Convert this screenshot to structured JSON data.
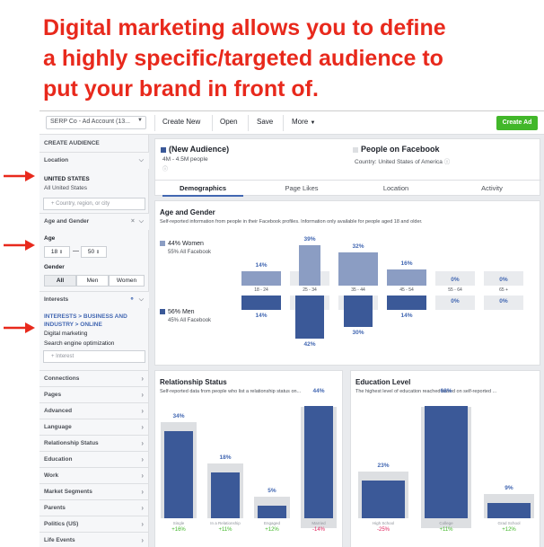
{
  "headline": {
    "line1": "Digital marketing allows you to define",
    "line2": "a highly specific/targeted audience to",
    "line3": "put your brand in front of."
  },
  "colors": {
    "headline": "#e8291c",
    "arrow": "#e8291c",
    "accent": "#4267b2",
    "women": "#8b9dc3",
    "men": "#3b5998",
    "green": "#42b72a",
    "negative": "#e0245e"
  },
  "topbar": {
    "account": "SERP Co - Ad Account (13...",
    "create_new": "Create New",
    "open": "Open",
    "save": "Save",
    "more": "More",
    "create_ad": "Create Ad"
  },
  "sidebar": {
    "title": "CREATE AUDIENCE",
    "location": {
      "header": "Location",
      "country": "UNITED STATES",
      "sub": "All United States",
      "placeholder": "Country, region, or city"
    },
    "age_gender": {
      "header": "Age and Gender",
      "age_label": "Age",
      "age_from": "18",
      "age_to": "50",
      "gender_label": "Gender",
      "options": [
        "All",
        "Men",
        "Women"
      ]
    },
    "interests": {
      "header": "Interests",
      "path": "INTERESTS > BUSINESS AND INDUSTRY > ONLINE",
      "items": [
        "Digital marketing",
        "Search engine optimization"
      ],
      "placeholder": "Interest"
    },
    "nav": [
      "Connections",
      "Pages",
      "Advanced",
      "Language",
      "Relationship Status",
      "Education",
      "Work",
      "Market Segments",
      "Parents",
      "Politics (US)",
      "Life Events"
    ]
  },
  "audience": {
    "new_title": "(New Audience)",
    "new_size": "4M - 4.5M people",
    "compare_title": "People on Facebook",
    "compare_sub": "Country: United States of America"
  },
  "tabs": [
    "Demographics",
    "Page Likes",
    "Location",
    "Activity"
  ],
  "age_gender_card": {
    "title": "Age and Gender",
    "desc": "Self-reported information from people in their Facebook profiles. Information only available for people aged 18 and older.",
    "women_label": "44% Women",
    "women_sub": "55% All Facebook",
    "men_label": "56% Men",
    "men_sub": "45% All Facebook"
  },
  "chart_data": [
    {
      "type": "bar",
      "title": "Age and Gender",
      "categories": [
        "18 - 24",
        "25 - 34",
        "35 - 44",
        "45 - 54",
        "55 - 64",
        "65 +"
      ],
      "series": [
        {
          "name": "44% Women",
          "values": [
            14,
            39,
            32,
            16,
            0,
            0
          ]
        },
        {
          "name": "56% Men",
          "values": [
            14,
            42,
            30,
            14,
            0,
            0
          ]
        }
      ]
    },
    {
      "type": "bar",
      "title": "Relationship Status",
      "subtitle": "Self-reported data from people who list a relationship status on...",
      "categories": [
        "Single",
        "In a Relationship",
        "Engaged",
        "Married"
      ],
      "values": [
        34,
        18,
        5,
        44
      ],
      "deltas": [
        "+16%",
        "+11%",
        "+12%",
        "-14%"
      ]
    },
    {
      "type": "bar",
      "title": "Education Level",
      "subtitle": "The highest level of education reached based on self-reported ...",
      "categories": [
        "High School",
        "College",
        "Grad School"
      ],
      "values": [
        23,
        68,
        9
      ],
      "deltas": [
        "-25%",
        "+11%",
        "+12%"
      ]
    }
  ]
}
